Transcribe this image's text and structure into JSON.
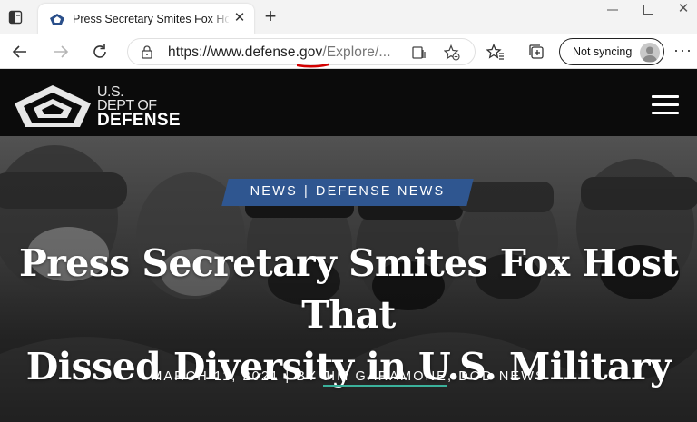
{
  "browser": {
    "tab": {
      "title": "Press Secretary Smites Fox Host",
      "close_glyph": "✕"
    },
    "new_tab_glyph": "+",
    "window_controls": {
      "minimize": "—",
      "maximize": "☐",
      "close": "✕"
    },
    "address": {
      "host": "https://www.defense.gov",
      "path": "/Explore/..."
    },
    "profile": {
      "label": "Not syncing"
    },
    "more_glyph": "···",
    "icons": [
      "tab-actions-icon",
      "back-icon",
      "forward-icon",
      "refresh-icon",
      "lock-icon",
      "reader-view-icon",
      "add-favorite-icon",
      "favorites-icon",
      "collections-icon",
      "profile-avatar-icon"
    ]
  },
  "site": {
    "brand": {
      "line1": "U.S.",
      "line2": "DEPT OF",
      "line3": "DEFENSE"
    },
    "menu_icon": "hamburger-menu-icon"
  },
  "article": {
    "categories": [
      "NEWS",
      "DEFENSE NEWS"
    ],
    "category_separator": "|",
    "headline_line1": "Press Secretary Smites Fox Host That",
    "headline_line2": "Dissed Diversity in U.S. Military",
    "date": "MARCH 11, 2021",
    "by_prefix": "BY",
    "author": "JIM GARAMONE",
    "source_suffix": ", DOD NEWS",
    "separator": "|"
  },
  "colors": {
    "category_bg": "#2f5690",
    "author_underline": "#3bb19b",
    "header_bg": "#0b0b0b",
    "address_underline": "#d40000"
  }
}
